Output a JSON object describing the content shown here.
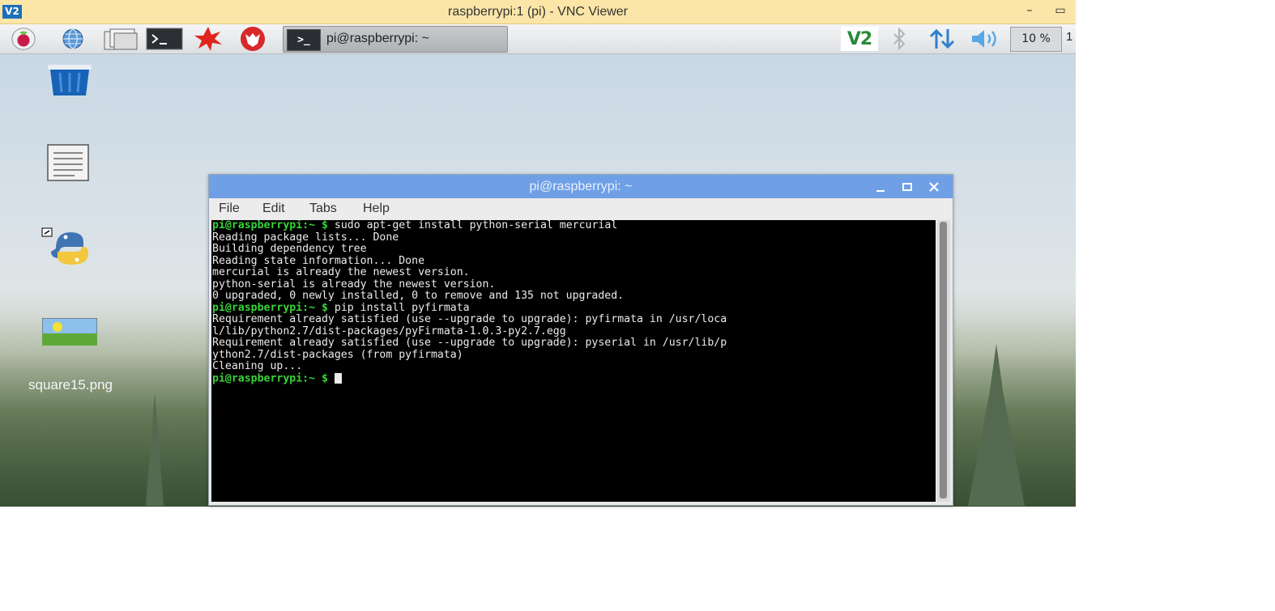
{
  "vnc": {
    "title": "raspberrypi:1 (pi) - VNC Viewer",
    "logo": "V2",
    "minimize_glyph": "–",
    "maximize_glyph": "▭"
  },
  "taskbar": {
    "launchers": [
      {
        "name": "raspberry-menu-icon"
      },
      {
        "name": "web-browser-icon"
      },
      {
        "name": "file-manager-icon"
      },
      {
        "name": "terminal-icon"
      },
      {
        "name": "mathematica-icon"
      },
      {
        "name": "wolfram-icon"
      }
    ],
    "task": {
      "label": "pi@raspberrypi: ~",
      "icon_text": ">_"
    },
    "tray": {
      "vnc_label": "V2",
      "cpu_text": "10 %",
      "clock_text": "1"
    }
  },
  "desktop": {
    "icons": [
      {
        "name": "trash-icon"
      },
      {
        "name": "text-file-icon"
      },
      {
        "name": "python-icon"
      },
      {
        "name": "image-file-icon",
        "label": "square15.png"
      }
    ]
  },
  "terminal": {
    "title": "pi@raspberrypi: ~",
    "menus": [
      "File",
      "Edit",
      "Tabs",
      "Help"
    ],
    "prompt": "pi@raspberrypi:~ $",
    "lines": [
      {
        "prompt": true,
        "text": "sudo apt-get install python-serial mercurial"
      },
      {
        "prompt": false,
        "text": "Reading package lists... Done"
      },
      {
        "prompt": false,
        "text": "Building dependency tree"
      },
      {
        "prompt": false,
        "text": "Reading state information... Done"
      },
      {
        "prompt": false,
        "text": "mercurial is already the newest version."
      },
      {
        "prompt": false,
        "text": "python-serial is already the newest version."
      },
      {
        "prompt": false,
        "text": "0 upgraded, 0 newly installed, 0 to remove and 135 not upgraded."
      },
      {
        "prompt": true,
        "text": "pip install pyfirmata"
      },
      {
        "prompt": false,
        "text": "Requirement already satisfied (use --upgrade to upgrade): pyfirmata in /usr/loca"
      },
      {
        "prompt": false,
        "text": "l/lib/python2.7/dist-packages/pyFirmata-1.0.3-py2.7.egg"
      },
      {
        "prompt": false,
        "text": "Requirement already satisfied (use --upgrade to upgrade): pyserial in /usr/lib/p"
      },
      {
        "prompt": false,
        "text": "ython2.7/dist-packages (from pyfirmata)"
      },
      {
        "prompt": false,
        "text": "Cleaning up..."
      },
      {
        "prompt": true,
        "text": "",
        "cursor": true
      }
    ]
  },
  "colors": {
    "vnc_titlebar": "#fbe6a8",
    "terminal_titlebar": "#6fa0e6",
    "prompt_green": "#38d438",
    "terminal_bg": "#000000"
  }
}
